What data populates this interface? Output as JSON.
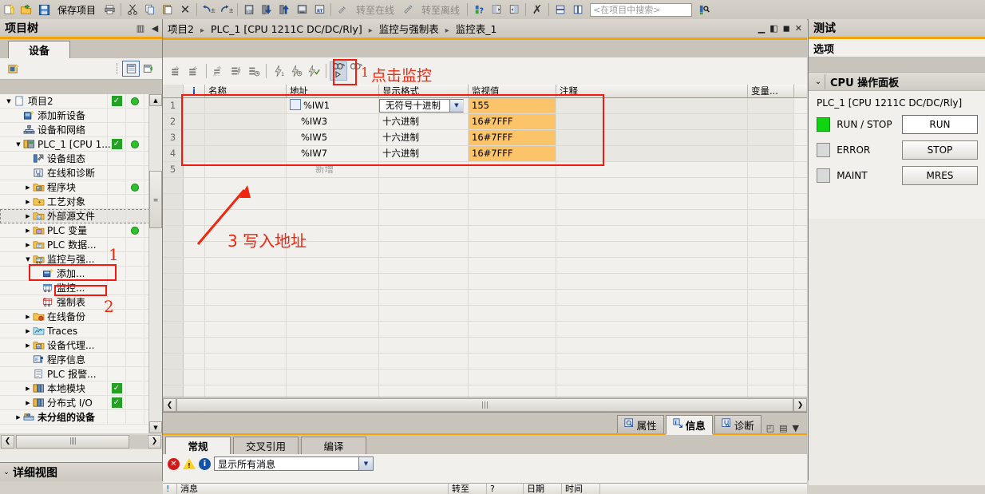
{
  "toolbar": {
    "save_label": "保存项目",
    "online_label": "转至在线",
    "offline_label": "转至离线",
    "search_placeholder": "<在项目中搜索>",
    "icons": [
      "new-project-icon",
      "open-project-icon",
      "save-icon",
      "print-icon",
      "cut-icon",
      "copy-icon",
      "paste-icon",
      "delete-icon",
      "undo-icon",
      "redo-icon",
      "compile-icon",
      "download-icon",
      "upload-icon",
      "start-simulation-icon",
      "start-runtime-icon",
      "go-online-icon",
      "go-offline-icon",
      "help-diagnostics-icon",
      "split-horizontal-icon",
      "split-vertical-icon",
      "close-icon",
      "window-split-h-icon",
      "window-split-v-icon",
      "search-run-icon"
    ]
  },
  "tree": {
    "title": "项目树",
    "tab_label": "设备",
    "items": [
      {
        "label": "项目2",
        "indent": 0,
        "arrow": "down",
        "icon": "project-icon",
        "check": true,
        "status": true
      },
      {
        "label": "添加新设备",
        "indent": 1,
        "arrow": "",
        "icon": "add-device-icon",
        "check": false,
        "status": false
      },
      {
        "label": "设备和网络",
        "indent": 1,
        "arrow": "",
        "icon": "devices-networks-icon",
        "check": false,
        "status": false
      },
      {
        "label": "PLC_1 [CPU 1...",
        "indent": 1,
        "arrow": "down",
        "icon": "plc-icon",
        "check": true,
        "status": true
      },
      {
        "label": "设备组态",
        "indent": 2,
        "arrow": "",
        "icon": "device-config-icon",
        "check": false,
        "status": false
      },
      {
        "label": "在线和诊断",
        "indent": 2,
        "arrow": "",
        "icon": "online-diagnostics-icon",
        "check": false,
        "status": false
      },
      {
        "label": "程序块",
        "indent": 2,
        "arrow": "right",
        "icon": "program-blocks-icon",
        "check": false,
        "status": true
      },
      {
        "label": "工艺对象",
        "indent": 2,
        "arrow": "right",
        "icon": "technology-objects-icon",
        "check": false,
        "status": false
      },
      {
        "label": "外部源文件",
        "indent": 2,
        "arrow": "right",
        "icon": "external-source-files-icon",
        "check": false,
        "status": false
      },
      {
        "label": "PLC 变量",
        "indent": 2,
        "arrow": "right",
        "icon": "plc-tags-icon",
        "check": false,
        "status": true
      },
      {
        "label": "PLC 数据...",
        "indent": 2,
        "arrow": "right",
        "icon": "plc-data-types-icon",
        "check": false,
        "status": false
      },
      {
        "label": "监控与强...",
        "indent": 2,
        "arrow": "down",
        "icon": "watch-force-tables-icon",
        "check": false,
        "status": false
      },
      {
        "label": "添加...",
        "indent": 3,
        "arrow": "",
        "icon": "add-new-watch-table-icon",
        "check": false,
        "status": false
      },
      {
        "label": "监控...",
        "indent": 3,
        "arrow": "",
        "icon": "watch-table-icon",
        "check": false,
        "status": false
      },
      {
        "label": "强制表",
        "indent": 3,
        "arrow": "",
        "icon": "force-table-icon",
        "check": false,
        "status": false
      },
      {
        "label": "在线备份",
        "indent": 2,
        "arrow": "right",
        "icon": "online-backups-icon",
        "check": false,
        "status": false
      },
      {
        "label": "Traces",
        "indent": 2,
        "arrow": "right",
        "icon": "traces-icon",
        "check": false,
        "status": false
      },
      {
        "label": "设备代理...",
        "indent": 2,
        "arrow": "right",
        "icon": "device-proxy-icon",
        "check": false,
        "status": false
      },
      {
        "label": "程序信息",
        "indent": 2,
        "arrow": "",
        "icon": "program-info-icon",
        "check": false,
        "status": false
      },
      {
        "label": "PLC 报警...",
        "indent": 2,
        "arrow": "",
        "icon": "plc-alarms-icon",
        "check": false,
        "status": false
      },
      {
        "label": "本地模块",
        "indent": 2,
        "arrow": "right",
        "icon": "local-modules-icon",
        "check": true,
        "status": false
      },
      {
        "label": "分布式 I/O",
        "indent": 2,
        "arrow": "right",
        "icon": "distributed-io-icon",
        "check": true,
        "status": false
      },
      {
        "label": "未分组的设备",
        "indent": 1,
        "arrow": "right",
        "icon": "ungrouped-devices-icon",
        "check": false,
        "status": false
      }
    ],
    "detail_view_label": "详细视图"
  },
  "editor": {
    "breadcrumb": [
      "项目2",
      "PLC_1 [CPU 1211C DC/DC/Rly]",
      "监控与强制表",
      "监控表_1"
    ],
    "window_buttons": [
      "minimize-button",
      "restore-button",
      "maximize-button",
      "close-button"
    ],
    "toolbar_icons": [
      "insert-row-icon",
      "insert-row-after-icon",
      "insert-rows-icon",
      "modify-icon",
      "modify-timed-icon",
      "force-once-icon",
      "force-timed-icon",
      "force-all-icon",
      "monitor-icon",
      "monitor-trigger-icon"
    ],
    "table": {
      "columns": [
        "",
        "i",
        "名称",
        "地址",
        "显示格式",
        "监视值",
        "注释",
        "变量..."
      ],
      "rows": [
        {
          "num": "1",
          "name": "",
          "address": "%IW1",
          "format": "无符号十进制",
          "format_is_combo": true,
          "value": "155",
          "comment": "",
          "variable": ""
        },
        {
          "num": "2",
          "name": "",
          "address": "%IW3",
          "format": "十六进制",
          "format_is_combo": false,
          "value": "16#7FFF",
          "comment": "",
          "variable": ""
        },
        {
          "num": "3",
          "name": "",
          "address": "%IW5",
          "format": "十六进制",
          "format_is_combo": false,
          "value": "16#7FFF",
          "comment": "",
          "variable": ""
        },
        {
          "num": "4",
          "name": "",
          "address": "%IW7",
          "format": "十六进制",
          "format_is_combo": false,
          "value": "16#7FFF",
          "comment": "",
          "variable": ""
        },
        {
          "num": "5",
          "name": "",
          "address": "新增",
          "format": "",
          "format_is_combo": false,
          "value": "",
          "comment": "",
          "variable": ""
        }
      ]
    }
  },
  "info_panel": {
    "tabs": [
      {
        "label": "属性",
        "icon": "properties-icon",
        "selected": false
      },
      {
        "label": "信息",
        "icon": "info-icon",
        "selected": true
      },
      {
        "label": "诊断",
        "icon": "diagnostics-icon",
        "selected": false
      }
    ],
    "sub_tabs": [
      {
        "label": "常规",
        "selected": true
      },
      {
        "label": "交叉引用",
        "selected": false
      },
      {
        "label": "编译",
        "selected": false
      }
    ],
    "filter_value": "显示所有消息",
    "message_columns": [
      "!",
      "消息",
      "转至",
      "?",
      "日期",
      "时间"
    ]
  },
  "test_panel": {
    "title": "测试",
    "options_label": "选项",
    "section_title": "CPU 操作面板",
    "device": "PLC_1 [CPU 1211C DC/DC/Rly]",
    "leds": [
      {
        "label": "RUN / STOP",
        "on": true,
        "button": "RUN",
        "primary": true
      },
      {
        "label": "ERROR",
        "on": false,
        "button": "STOP",
        "primary": false
      },
      {
        "label": "MAINT",
        "on": false,
        "button": "MRES",
        "primary": false
      }
    ]
  },
  "annotations": [
    {
      "id": "a1",
      "text": "点击监控",
      "kind": "text"
    },
    {
      "id": "a2",
      "text": "3 写入地址",
      "kind": "text"
    },
    {
      "id": "n1",
      "text": "1",
      "kind": "number"
    },
    {
      "id": "n2",
      "text": "2",
      "kind": "number"
    },
    {
      "id": "n3",
      "text": "1",
      "kind": "number"
    }
  ],
  "colors": {
    "accent": "#f0a30a",
    "annotation_red": "#f0260f",
    "monitor_value_bg": "#fcc46a",
    "led_on": "#11d411",
    "check_green": "#23a124"
  }
}
